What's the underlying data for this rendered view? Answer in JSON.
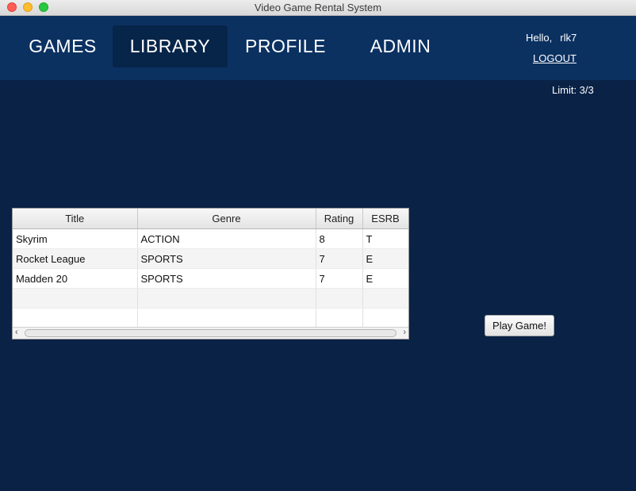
{
  "window": {
    "title": "Video Game Rental System"
  },
  "nav": {
    "items": [
      {
        "label": "GAMES"
      },
      {
        "label": "LIBRARY"
      },
      {
        "label": "PROFILE"
      },
      {
        "label": "ADMIN"
      }
    ],
    "active": "LIBRARY"
  },
  "user": {
    "greeting": "Hello,",
    "username": "rlk7",
    "logout_label": "LOGOUT"
  },
  "limit_text": "Limit: 3/3",
  "table": {
    "columns": [
      "Title",
      "Genre",
      "Rating",
      "ESRB"
    ],
    "rows": [
      [
        "Skyrim",
        "ACTION",
        "8",
        "T"
      ],
      [
        "Rocket League",
        "SPORTS",
        "7",
        "E"
      ],
      [
        "Madden 20",
        "SPORTS",
        "7",
        "E"
      ]
    ]
  },
  "play_button_label": "Play Game!",
  "colors": {
    "background": "#0a2246",
    "navbar": "#0b3161",
    "nav_active": "#072549"
  }
}
